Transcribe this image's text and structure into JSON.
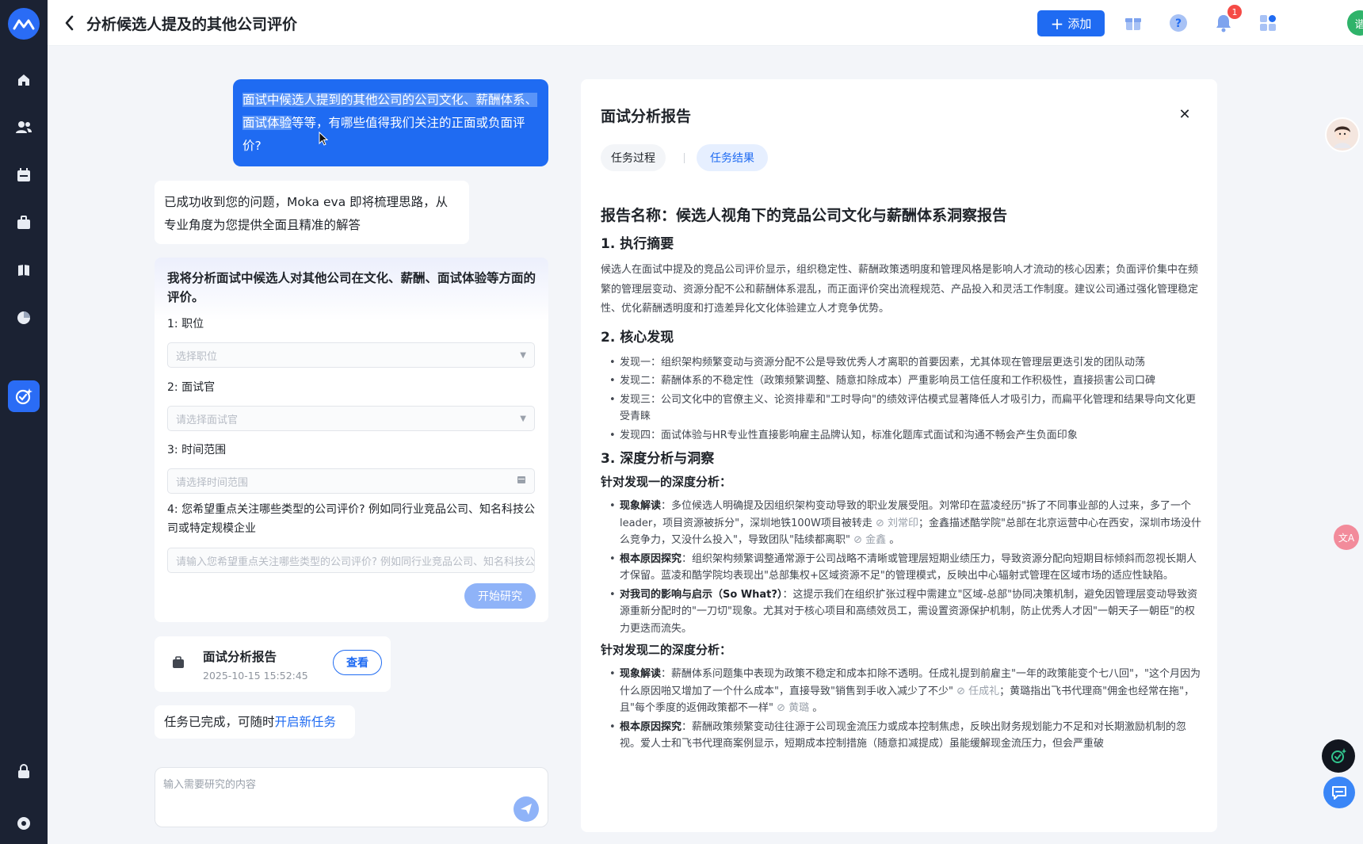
{
  "app": {
    "title": "分析候选人提及的其他公司评价"
  },
  "header": {
    "add_label": "添加",
    "notification_count": "1",
    "avatar_text": "谐"
  },
  "chat": {
    "user_question_selected": "面试中候选人提到的其他公司的公司文化、薪酬体系、面试体验",
    "user_question_rest": "等等，有哪些值得我们关注的正面或负面评价?",
    "bot_ack": "已成功收到您的问题，Moka eva 即将梳理思路，从专业角度为您提供全面且精准的解答",
    "form": {
      "heading": "我将分析面试中候选人对其他公司在文化、薪酬、面试体验等方面的评价。",
      "fields": [
        {
          "label": "1: 职位",
          "placeholder": "选择职位"
        },
        {
          "label": "2: 面试官",
          "placeholder": "请选择面试官"
        },
        {
          "label": "3: 时间范围",
          "placeholder": "请选择时间范围"
        },
        {
          "label": "4: 您希望重点关注哪些类型的公司评价? 例如同行业竞品公司、知名科技公司或特定规模企业",
          "placeholder": "请输入您希望重点关注哪些类型的公司评价? 例如同行业竞品公司、知名科技公司或特定规模企业"
        }
      ],
      "start_label": "开始研究"
    },
    "report_card": {
      "title": "面试分析报告",
      "time": "2025-10-15 15:52:45",
      "view_label": "查看"
    },
    "done_text": "任务已完成，可随时",
    "done_link": "开启新任务",
    "composer_placeholder": "输入需要研究的内容"
  },
  "panel": {
    "title": "面试分析报告",
    "tabs": [
      "任务过程",
      "任务结果"
    ],
    "report_name": "报告名称：候选人视角下的竞品公司文化与薪酬体系洞察报告",
    "s1_title": "1. 执行摘要",
    "s1_text": "候选人在面试中提及的竞品公司评价显示，组织稳定性、薪酬政策透明度和管理风格是影响人才流动的核心因素；负面评价集中在频繁的管理层变动、资源分配不公和薪酬体系混乱，而正面评价突出流程规范、产品投入和灵活工作制度。建议公司通过强化管理稳定性、优化薪酬透明度和打造差异化文化体验建立人才竞争优势。",
    "s2_title": "2. 核心发现",
    "s2_items": [
      "发现一：组织架构频繁变动与资源分配不公是导致优秀人才离职的首要因素，尤其体现在管理层更迭引发的团队动荡",
      "发现二：薪酬体系的不稳定性（政策频繁调整、随意扣除成本）严重影响员工信任度和工作积极性，直接损害公司口碑",
      "发现三：公司文化中的官僚主义、论资排辈和\"工时导向\"的绩效评估模式显著降低人才吸引力，而扁平化管理和结果导向文化更受青睐",
      "发现四：面试体验与HR专业性直接影响雇主品牌认知，标准化题库式面试和沟通不畅会产生负面印象"
    ],
    "s3_title": "3. 深度分析与洞察",
    "s3_sub1": "针对发现一的深度分析：",
    "s3_sub1_items": [
      {
        "label": "现象解读",
        "text": "：多位候选人明确提及因组织架构变动导致的职业发展受阻。刘常印在蓝凌经历\"拆了不同事业部的人过来，多了一个leader，项目资源被拆分\"，深圳地铁100W项目被转走",
        "cite1": "刘常印",
        "mid": "；金鑫描述酷学院\"总部在北京运营中心在西安，深圳市场没什么竞争力，又没什么投入\"，导致团队\"陆续都离职\"",
        "cite2": "金鑫",
        "end": "。"
      },
      {
        "label": "根本原因探究",
        "text": "：组织架构频繁调整通常源于公司战略不清晰或管理层短期业绩压力，导致资源分配向短期目标倾斜而忽视长期人才保留。蓝凌和酷学院均表现出\"总部集权+区域资源不足\"的管理模式，反映出中心辐射式管理在区域市场的适应性缺陷。"
      },
      {
        "label": "对我司的影响与启示（So What?）",
        "text": "：这提示我们在组织扩张过程中需建立\"区域-总部\"协同决策机制，避免因管理层变动导致资源重新分配时的\"一刀切\"现象。尤其对于核心项目和高绩效员工，需设置资源保护机制，防止优秀人才因\"一朝天子一朝臣\"的权力更迭而流失。"
      }
    ],
    "s3_sub2": "针对发现二的深度分析：",
    "s3_sub2_items": [
      {
        "label": "现象解读",
        "text": "：薪酬体系问题集中表现为政策不稳定和成本扣除不透明。任成礼提到前雇主\"一年的政策能变个七八回\"，\"这个月因为什么原因啪又增加了一个什么成本\"，直接导致\"销售到手收入减少了不少\"",
        "cite1": "任成礼",
        "mid": "；黄璐指出飞书代理商\"佣金也经常在拖\"，且\"每个季度的返佣政策都不一样\"",
        "cite2": "黄璐",
        "end": "。"
      },
      {
        "label": "根本原因探究",
        "text": "：薪酬政策频繁变动往往源于公司现金流压力或成本控制焦虑，反映出财务规划能力不足和对长期激励机制的忽视。爱人士和飞书代理商案例显示，短期成本控制措施（随意扣减提成）虽能缓解现金流压力，但会严重破"
      }
    ]
  }
}
